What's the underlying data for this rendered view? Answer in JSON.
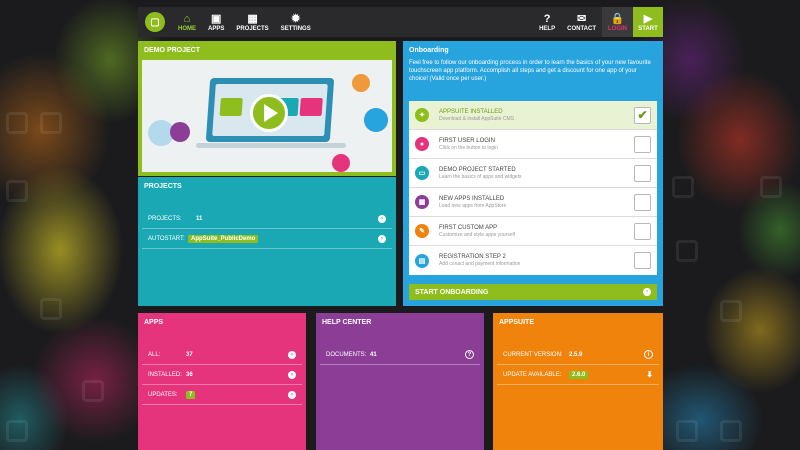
{
  "header": {
    "logo_icon": "monitor-logo-icon",
    "nav": [
      {
        "label": "HOME",
        "icon": "home-icon"
      },
      {
        "label": "APPS",
        "icon": "apps-icon"
      },
      {
        "label": "PROJECTS",
        "icon": "projects-icon"
      },
      {
        "label": "SETTINGS",
        "icon": "gear-icon"
      }
    ],
    "right": [
      {
        "label": "HELP",
        "icon": "question-icon"
      },
      {
        "label": "CONTACT",
        "icon": "mail-icon"
      },
      {
        "label": "LOGIN",
        "icon": "lock-icon"
      },
      {
        "label": "START",
        "icon": "play-icon"
      }
    ]
  },
  "demo": {
    "title": "DEMO PROJECT"
  },
  "projects": {
    "title": "PROJECTS",
    "rows": [
      {
        "label": "PROJECTS:",
        "value": "11"
      },
      {
        "label": "AUTOSTART:",
        "value": "AppSuite_PublicDemo"
      }
    ]
  },
  "onboarding": {
    "title": "Onboarding",
    "intro": "Feel free to follow our onboarding process in order to learn the basics of your new favourite touchscreen app platform. Accomplish all steps and get a discount for one app of your choice! (Valid once per user.)",
    "steps": [
      {
        "title": "APPSUITE INSTALLED",
        "subtitle": "Download & install AppSuite CMS",
        "done": true,
        "color": "#8fbd1e"
      },
      {
        "title": "FIRST USER LOGIN",
        "subtitle": "Click on the button to login",
        "done": false,
        "color": "#e6347c"
      },
      {
        "title": "DEMO PROJECT STARTED",
        "subtitle": "Learn the basics of apps and widgets",
        "done": false,
        "color": "#1aa9b4"
      },
      {
        "title": "NEW APPS INSTALLED",
        "subtitle": "Load new apps from AppStore",
        "done": false,
        "color": "#8c3d96"
      },
      {
        "title": "FIRST CUSTOM APP",
        "subtitle": "Customize and style apps yourself",
        "done": false,
        "color": "#ef830c"
      },
      {
        "title": "REGISTRATION STEP 2",
        "subtitle": "Add conact and payment information",
        "done": false,
        "color": "#27a3de"
      }
    ],
    "start_label": "START ONBOARDING"
  },
  "apps": {
    "title": "APPS",
    "rows": [
      {
        "label": "ALL:",
        "value": "37"
      },
      {
        "label": "INSTALLED:",
        "value": "36"
      },
      {
        "label": "UPDATES:",
        "value": "7"
      }
    ]
  },
  "help": {
    "title": "HELP CENTER",
    "rows": [
      {
        "label": "DOCUMENTS:",
        "value": "41"
      }
    ]
  },
  "appsuite": {
    "title": "APPSUITE",
    "rows": [
      {
        "label": "CURRENT VERSION:",
        "value": "2.5.9"
      },
      {
        "label": "UPDATE AVAILABLE:",
        "value": "2.6.0"
      }
    ]
  }
}
